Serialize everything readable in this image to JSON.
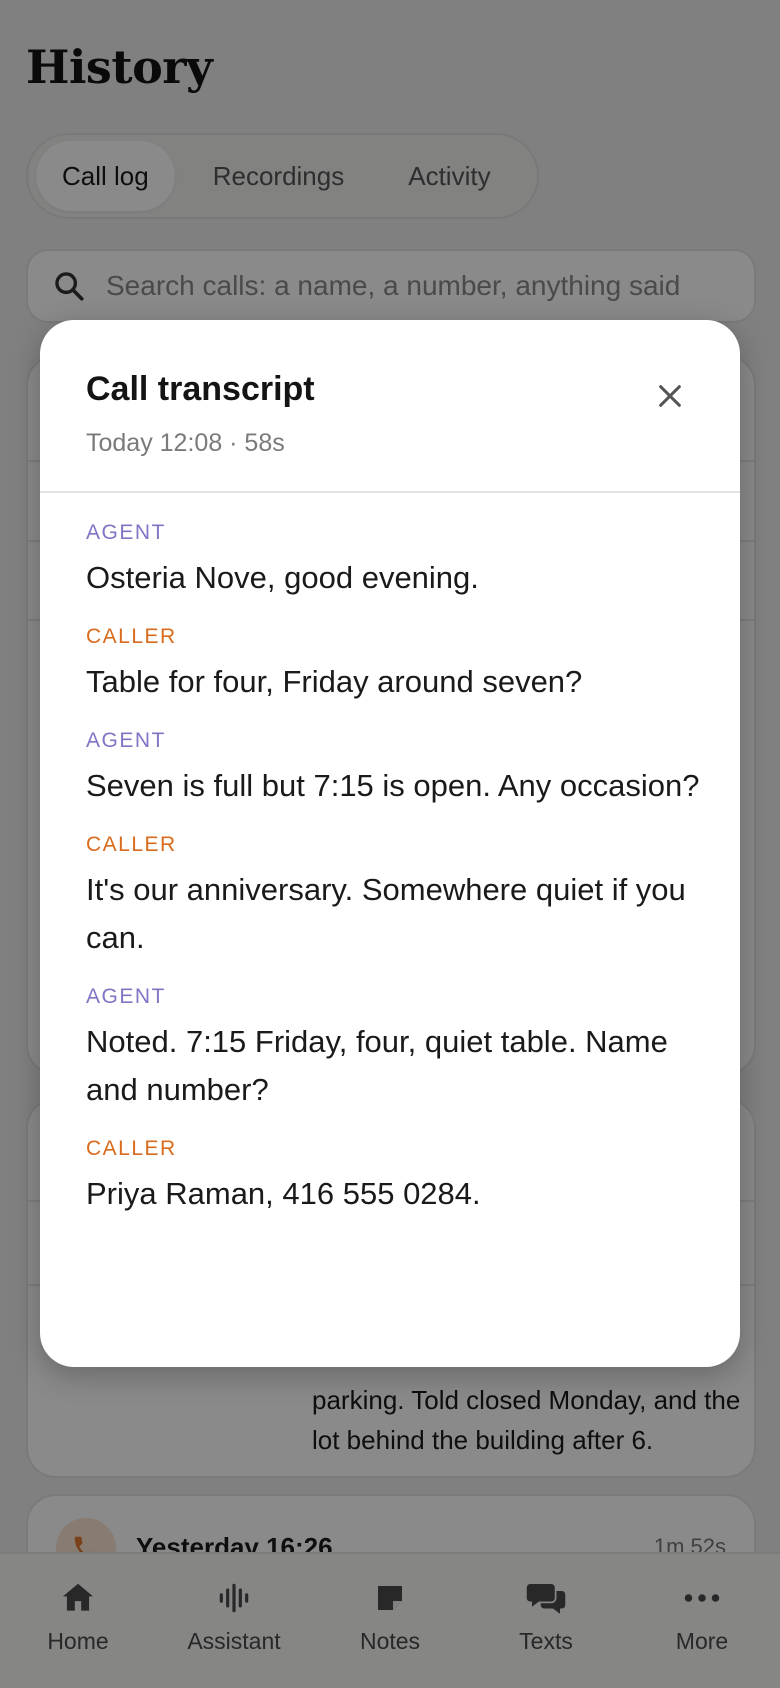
{
  "page": {
    "title": "History",
    "tabs": [
      {
        "label": "Call log",
        "active": true
      },
      {
        "label": "Recordings",
        "active": false
      },
      {
        "label": "Activity",
        "active": false
      }
    ],
    "search": {
      "icon": "search-icon",
      "placeholder": "Search calls: a name, a number, anything said"
    },
    "background_card_text": "parking. Told closed Monday, and the lot behind the building after 6.",
    "next_call": {
      "icon": "phone-icon",
      "time": "Yesterday 16:26",
      "duration": "1m 52s"
    }
  },
  "modal": {
    "title": "Call transcript",
    "meta": "Today 12:08 · 58s",
    "close_icon": "close-icon",
    "turns": [
      {
        "speaker": "AGENT",
        "role": "agent",
        "text": "Osteria Nove, good evening."
      },
      {
        "speaker": "CALLER",
        "role": "caller",
        "text": "Table for four, Friday around seven?"
      },
      {
        "speaker": "AGENT",
        "role": "agent",
        "text": "Seven is full but 7:15 is open. Any occasion?"
      },
      {
        "speaker": "CALLER",
        "role": "caller",
        "text": "It's our anniversary. Somewhere quiet if you can."
      },
      {
        "speaker": "AGENT",
        "role": "agent",
        "text": "Noted. 7:15 Friday, four, quiet table. Name and number?"
      },
      {
        "speaker": "CALLER",
        "role": "caller",
        "text": "Priya Raman, 416 555 0284."
      }
    ]
  },
  "bottom_nav": [
    {
      "label": "Home",
      "icon": "home-icon"
    },
    {
      "label": "Assistant",
      "icon": "waveform-icon"
    },
    {
      "label": "Notes",
      "icon": "note-icon"
    },
    {
      "label": "Texts",
      "icon": "chat-bubbles-icon"
    },
    {
      "label": "More",
      "icon": "more-dots-icon"
    }
  ],
  "colors": {
    "agent_label": "#8075c4",
    "caller_label": "#d86b1c",
    "phone_accent": "#e07a2f"
  }
}
